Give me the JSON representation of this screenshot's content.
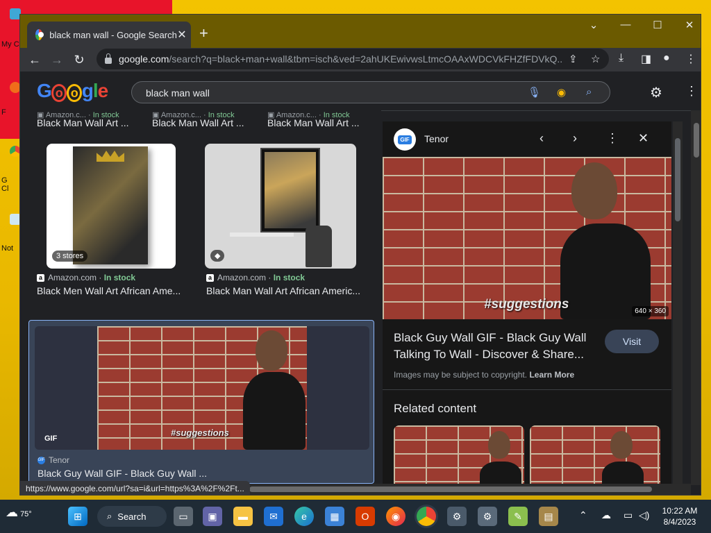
{
  "desktop": {
    "icons": [
      {
        "label": "My C"
      },
      {
        "label": "F"
      },
      {
        "label": "G\nCl"
      },
      {
        "label": "Not"
      }
    ]
  },
  "browser": {
    "tab_title": "black man wall - Google Search",
    "tab_close": "✕",
    "new_tab": "+",
    "url_host": "google.com",
    "url_path": "/search?q=black+man+wall&tbm=isch&ved=2ahUKEwivwsLtmcOAAxWDCVkFHZfFDVkQ...",
    "status_url": "https://www.google.com/url?sa=i&url=https%3A%2F%2Ft..."
  },
  "google": {
    "logo": "Google",
    "query": "black man wall"
  },
  "results": {
    "top_row": [
      {
        "source": "Amazon.c...",
        "stock": "In stock",
        "title": "Black Man Wall Art ..."
      },
      {
        "source": "Amazon.c...",
        "stock": "In stock",
        "title": "Black Man Wall Art ..."
      },
      {
        "source": "Amazon.c...",
        "stock": "In stock",
        "title": "Black Man Wall Art ..."
      }
    ],
    "card1": {
      "badge": "3 stores",
      "source": "Amazon.com",
      "sep": "·",
      "stock": "In stock",
      "title": "Black Men Wall Art African Ame..."
    },
    "card2": {
      "source": "Amazon.com",
      "sep": "·",
      "stock": "In stock",
      "title": "Black Man Wall Art African Americ..."
    },
    "card3": {
      "gif": "GIF",
      "overlay": "#suggestions",
      "source": "Tenor",
      "title": "Black Guy Wall GIF - Black Guy Wall ..."
    }
  },
  "panel": {
    "site": "Tenor",
    "tenor_logo": "GIF",
    "overlay": "#suggestions",
    "dimensions": "640 × 360",
    "title": "Black Guy Wall GIF - Black Guy Wall Talking To Wall - Discover & Share...",
    "visit": "Visit",
    "copyright": "Images may be subject to copyright.",
    "learn_more": "Learn More",
    "related": "Related content"
  },
  "taskbar": {
    "temp": "75°",
    "search": "Search",
    "time": "10:22 AM",
    "date": "8/4/2023"
  },
  "colors": {
    "accent": "#8ab4f8",
    "in_stock": "#81c995",
    "selected_bg": "#394457"
  }
}
